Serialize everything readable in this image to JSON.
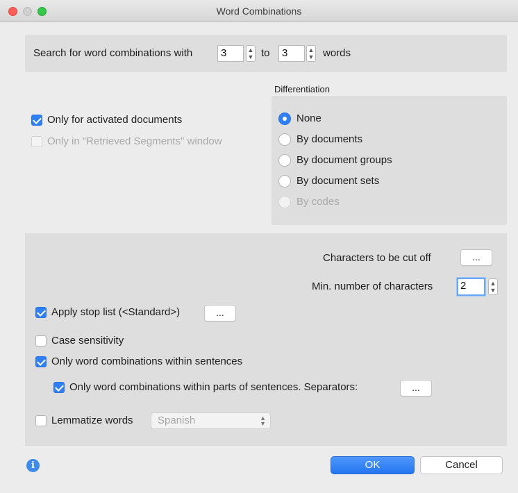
{
  "window": {
    "title": "Word Combinations"
  },
  "search": {
    "prefix": "Search for word combinations with",
    "from_value": "3",
    "to_label": "to",
    "to_value": "3",
    "suffix": "words"
  },
  "scope": {
    "only_activated": {
      "label": "Only for activated documents",
      "checked": true
    },
    "only_retrieved": {
      "label": "Only in \"Retrieved Segments\" window",
      "checked": false,
      "disabled": true
    }
  },
  "differentiation": {
    "heading": "Differentiation",
    "options": [
      {
        "label": "None",
        "selected": true
      },
      {
        "label": "By documents"
      },
      {
        "label": "By document groups"
      },
      {
        "label": "By document sets"
      },
      {
        "label": "By codes",
        "disabled": true
      }
    ]
  },
  "options": {
    "cut_off_label": "Characters to be cut off",
    "cut_off_button": "...",
    "min_chars_label": "Min. number of characters",
    "min_chars_value": "2",
    "stop_list": {
      "label": "Apply stop list (<Standard>)",
      "checked": true,
      "button": "..."
    },
    "case_sensitivity": {
      "label": "Case sensitivity",
      "checked": false
    },
    "within_sentences": {
      "label": "Only word combinations within sentences",
      "checked": true
    },
    "within_parts": {
      "label": "Only word combinations within parts of sentences. Separators:",
      "checked": true,
      "button": "..."
    },
    "lemmatize": {
      "label": "Lemmatize words",
      "checked": false,
      "language": "Spanish"
    }
  },
  "footer": {
    "ok_label": "OK",
    "cancel_label": "Cancel"
  },
  "colors": {
    "accent": "#2f7ff5",
    "close": "#fc5f57",
    "zoom": "#34c84a"
  },
  "icons": {
    "info": "info-icon",
    "stepper": "stepper-arrows-icon",
    "select": "chevron-updown-icon"
  }
}
